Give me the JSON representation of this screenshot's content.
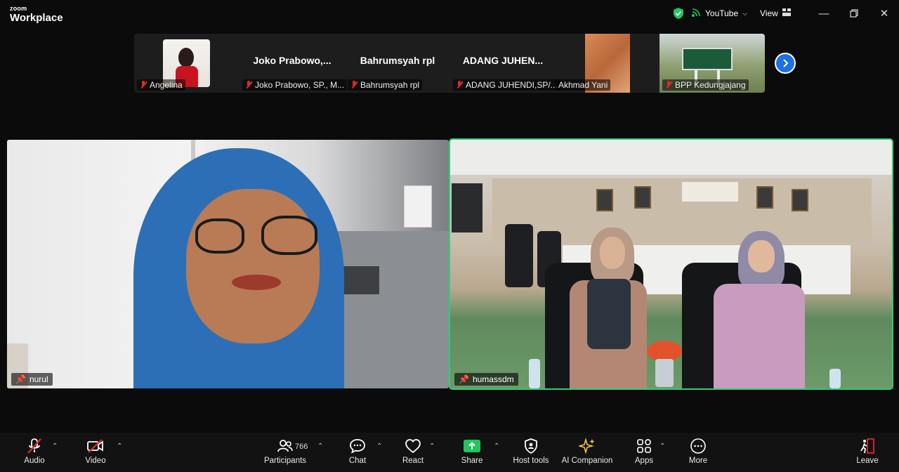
{
  "app": {
    "brand_small": "zoom",
    "brand_big": "Workplace"
  },
  "titlebar": {
    "youtube_label": "YouTube",
    "view_label": "View"
  },
  "thumbnails": [
    {
      "display": "",
      "caption": "Angelina"
    },
    {
      "display": "Joko  Prabowo,...",
      "caption": "Joko Prabowo, SP., M..."
    },
    {
      "display": "Bahrumsyah rpl",
      "caption": "Bahrumsyah rpl"
    },
    {
      "display": "ADANG  JUHEN...",
      "caption": "ADANG JUHENDI,SP/..."
    },
    {
      "display": "",
      "caption": "Akhmad Yani"
    },
    {
      "display": "",
      "caption": "BPP Kedungjajang"
    }
  ],
  "videos": [
    {
      "name": "nurul"
    },
    {
      "name": "humassdm"
    }
  ],
  "toolbar": {
    "audio": "Audio",
    "video": "Video",
    "participants": "Participants",
    "participants_count": "766",
    "chat": "Chat",
    "react": "React",
    "share": "Share",
    "host_tools": "Host tools",
    "ai_companion": "AI Companion",
    "apps": "Apps",
    "more": "More",
    "leave": "Leave"
  },
  "colors": {
    "accent_green": "#28d07a",
    "share_green": "#22c55e",
    "next_blue": "#1f6fe5",
    "muted_red": "#e02828"
  }
}
